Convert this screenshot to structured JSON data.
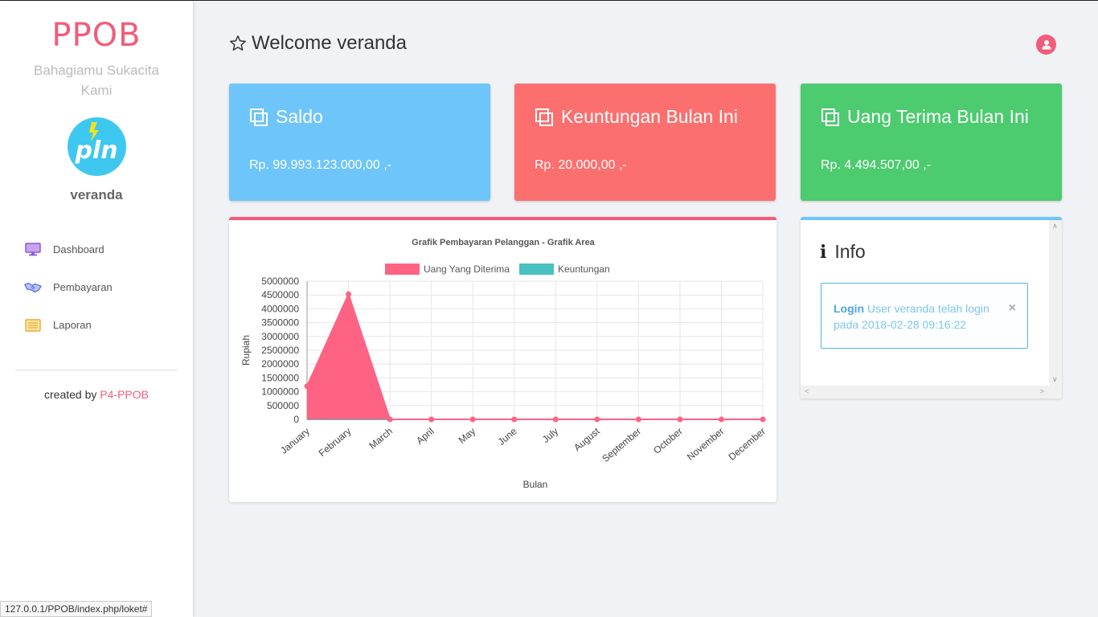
{
  "sidebar": {
    "brand": "PPOB",
    "tagline": "Bahagiamu Sukacita Kami",
    "logo_text": "pln",
    "username": "veranda",
    "items": [
      {
        "label": "Dashboard",
        "icon": "monitor-icon"
      },
      {
        "label": "Pembayaran",
        "icon": "handshake-icon"
      },
      {
        "label": "Laporan",
        "icon": "list-icon"
      }
    ],
    "credit_prefix": "created by",
    "credit_link": "P4-PPOB"
  },
  "header": {
    "welcome": "Welcome veranda",
    "star_icon": "star-icon",
    "user_icon": "user-icon"
  },
  "cards": [
    {
      "title": "Saldo",
      "value": "Rp. 99.993.123.000,00 ,-",
      "color": "#6ec5f9"
    },
    {
      "title": "Keuntungan Bulan Ini",
      "value": "Rp. 20.000,00 ,-",
      "color": "#fc6f6f"
    },
    {
      "title": "Uang Terima Bulan Ini",
      "value": "Rp. 4.494.507,00 ,-",
      "color": "#4ccb6f"
    }
  ],
  "info": {
    "title": "Info",
    "alert_strong": "Login",
    "alert_text": " User veranda telah login pada 2018-02-28 09:16:22",
    "close": "×"
  },
  "status_url": "127.0.0.1/PPOB/index.php/loket#",
  "chart_data": {
    "type": "area",
    "title": "Grafik Pembayaran Pelanggan - Grafik Area",
    "xlabel": "Bulan",
    "ylabel": "Rupiah",
    "categories": [
      "January",
      "February",
      "March",
      "April",
      "May",
      "June",
      "July",
      "August",
      "September",
      "October",
      "November",
      "December"
    ],
    "ylim": [
      0,
      5000000
    ],
    "yticks": [
      "5000000",
      "4500000",
      "4000000",
      "3500000",
      "3000000",
      "2500000",
      "2000000",
      "1500000",
      "1000000",
      "500000",
      "0"
    ],
    "series": [
      {
        "name": "Uang Yang Diterima",
        "color": "#ff6384",
        "values": [
          1200000,
          4530000,
          0,
          0,
          0,
          0,
          0,
          0,
          0,
          0,
          0,
          0
        ]
      },
      {
        "name": "Keuntungan",
        "color": "#4bc0c0",
        "values": [
          0,
          0,
          0,
          0,
          0,
          0,
          0,
          0,
          0,
          0,
          0,
          0
        ]
      }
    ],
    "legend": "top",
    "grid": true
  }
}
